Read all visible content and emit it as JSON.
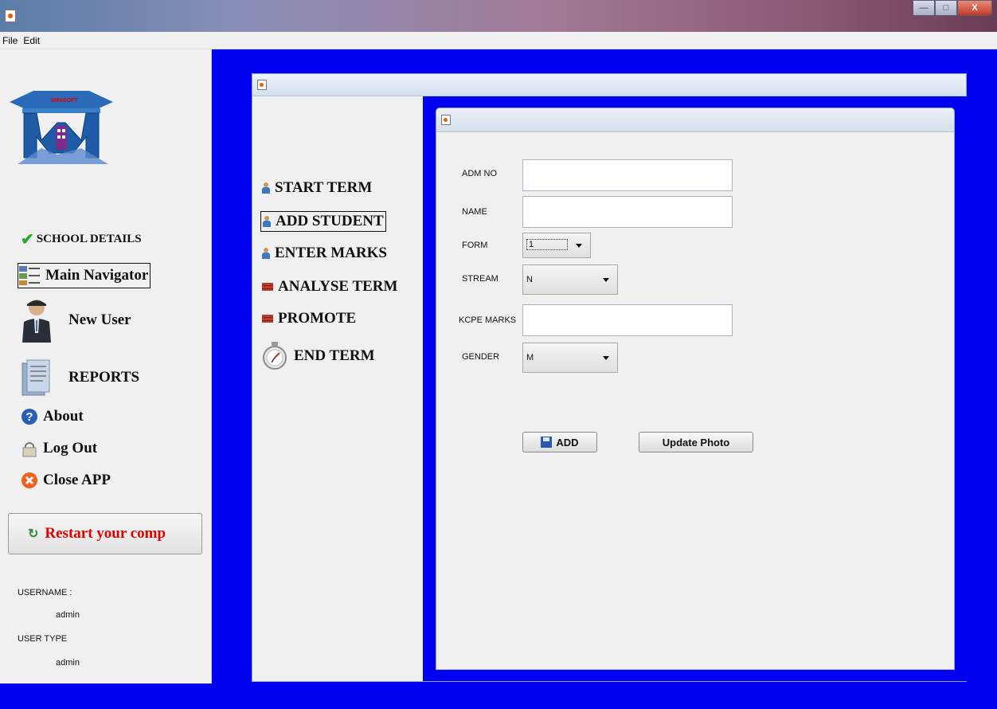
{
  "menubar": {
    "file": "File",
    "edit": "Edit"
  },
  "sidebar": {
    "logo_text": "MINISOFT",
    "school_details": "SCHOOL DETAILS",
    "main_navigator": "Main Navigator",
    "new_user": "New User",
    "reports": "REPORTS",
    "about": "About",
    "log_out": "Log Out",
    "close_app": "Close APP",
    "restart": "Restart your comp",
    "username_label": "USERNAME :",
    "username_value": "admin",
    "user_type_label": "USER TYPE",
    "user_type_value": "admin"
  },
  "term_menu": {
    "start_term": "START TERM",
    "add_student": "ADD STUDENT",
    "enter_marks": "ENTER MARKS",
    "analyse_term": "ANALYSE TERM",
    "promote": "PROMOTE",
    "end_term": "END TERM"
  },
  "form": {
    "adm_no_label": "ADM NO",
    "name_label": "NAME",
    "form_label": "FORM",
    "form_value": "1",
    "stream_label": "STREAM",
    "stream_value": "N",
    "kcpe_label": "KCPE MARKS",
    "gender_label": "GENDER",
    "gender_value": "M",
    "add_button": "ADD",
    "update_photo_button": "Update Photo"
  }
}
